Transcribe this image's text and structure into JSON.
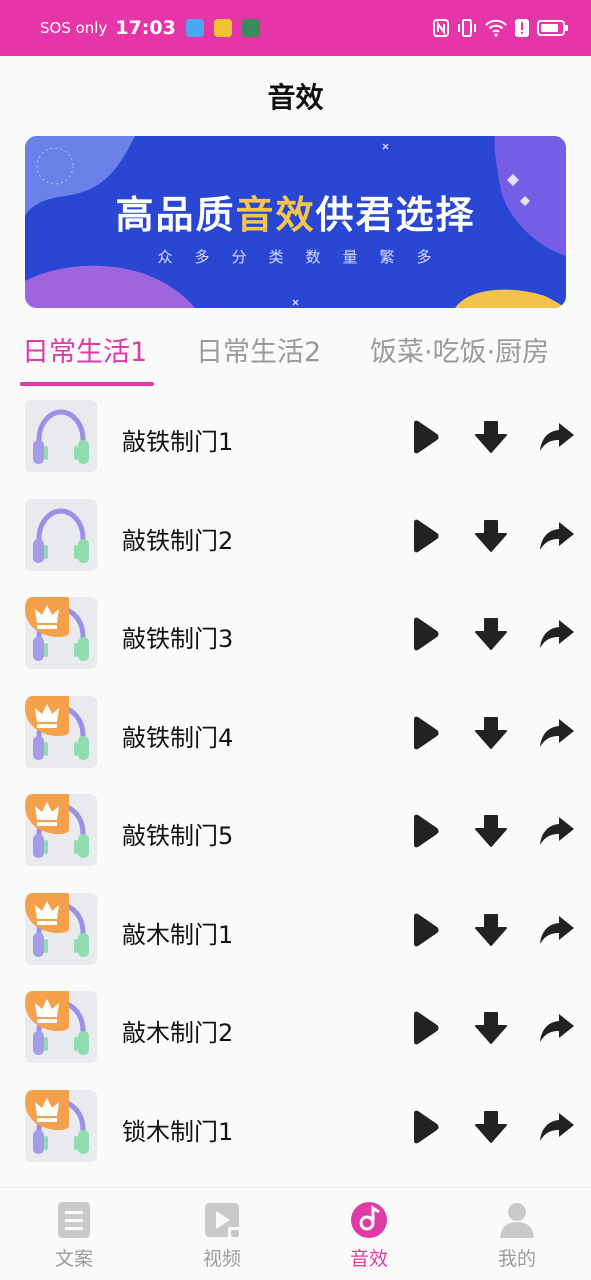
{
  "status_bar": {
    "carrier": "SOS only",
    "time": "17:03"
  },
  "header": {
    "title": "音效"
  },
  "banner": {
    "headline_prefix": "高品质",
    "headline_highlight": "音效",
    "headline_suffix": "供君选择",
    "subtitle": "众多分类数量繁多"
  },
  "tabs": [
    {
      "label": "日常生活1",
      "active": true
    },
    {
      "label": "日常生活2",
      "active": false
    },
    {
      "label": "饭菜·吃饭·厨房",
      "active": false
    }
  ],
  "sounds": [
    {
      "title": "敲铁制门1",
      "vip": false
    },
    {
      "title": "敲铁制门2",
      "vip": false
    },
    {
      "title": "敲铁制门3",
      "vip": true
    },
    {
      "title": "敲铁制门4",
      "vip": true
    },
    {
      "title": "敲铁制门5",
      "vip": true
    },
    {
      "title": "敲木制门1",
      "vip": true
    },
    {
      "title": "敲木制门2",
      "vip": true
    },
    {
      "title": "锁木制门1",
      "vip": true
    }
  ],
  "bottom_nav": [
    {
      "label": "文案",
      "icon": "document-icon",
      "active": false
    },
    {
      "label": "视频",
      "icon": "video-icon",
      "active": false
    },
    {
      "label": "音效",
      "icon": "music-disc-icon",
      "active": true
    },
    {
      "label": "我的",
      "icon": "user-icon",
      "active": false
    }
  ],
  "colors": {
    "accent": "#e03aa6",
    "status_bar": "#e535a8",
    "banner_bg": "#2a47d4",
    "banner_highlight": "#f5c64a",
    "vip_badge": "#f5a04a",
    "icon_dark": "#222222",
    "inactive_text": "#9a9a9a"
  }
}
